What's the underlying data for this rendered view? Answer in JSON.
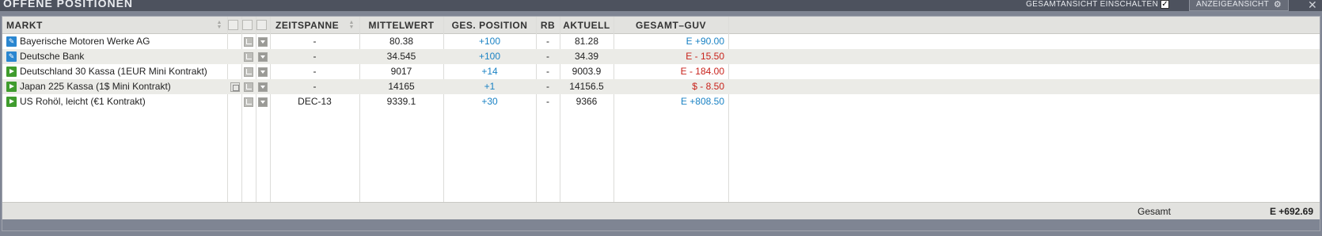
{
  "window": {
    "title": "OFFENE POSITIONEN",
    "gesamtansicht_label": "GESAMTANSICHT EINSCHALTEN",
    "gesamtansicht_checked": "✓",
    "anzeigeansicht_label": "ANZEIGEANSICHT",
    "close_glyph": "✕"
  },
  "columns": {
    "markt": "MARKT",
    "zeitspanne": "ZEITSPANNE",
    "mittelwert": "MITTELWERT",
    "ges_position": "GES. POSITION",
    "rb": "RB",
    "aktuell": "AKTUELL",
    "gesamt_guv": "GESAMT–GUV"
  },
  "rows": [
    {
      "icon": "edit-icon",
      "markt": "Bayerische Motoren Werke AG",
      "has_doc": false,
      "zeitspanne": "-",
      "mittelwert": "80.38",
      "position": "+100",
      "rb": "-",
      "aktuell": "81.28",
      "guv": "E +90.00",
      "guv_color": "blue"
    },
    {
      "icon": "edit-icon",
      "markt": "Deutsche Bank",
      "has_doc": false,
      "zeitspanne": "-",
      "mittelwert": "34.545",
      "position": "+100",
      "rb": "-",
      "aktuell": "34.39",
      "guv": "E - 15.50",
      "guv_color": "red"
    },
    {
      "icon": "play-icon",
      "markt": "Deutschland 30 Kassa (1EUR Mini Kontrakt)",
      "has_doc": false,
      "zeitspanne": "-",
      "mittelwert": "9017",
      "position": "+14",
      "rb": "-",
      "aktuell": "9003.9",
      "guv": "E - 184.00",
      "guv_color": "red"
    },
    {
      "icon": "play-icon",
      "markt": "Japan 225 Kassa (1$ Mini Kontrakt)",
      "has_doc": true,
      "zeitspanne": "-",
      "mittelwert": "14165",
      "position": "+1",
      "rb": "-",
      "aktuell": "14156.5",
      "guv": "$ - 8.50",
      "guv_color": "red"
    },
    {
      "icon": "play-icon",
      "markt": "US Rohöl, leicht (€1 Kontrakt)",
      "has_doc": false,
      "zeitspanne": "DEC-13",
      "mittelwert": "9339.1",
      "position": "+30",
      "rb": "-",
      "aktuell": "9366",
      "guv": "E +808.50",
      "guv_color": "blue"
    }
  ],
  "footer": {
    "label": "Gesamt",
    "total": "E +692.69"
  },
  "colors": {
    "positive": "#1a82c4",
    "negative": "#c8221b",
    "header_bg": "#e2e2df",
    "titlebar_bg": "#4d525e"
  }
}
